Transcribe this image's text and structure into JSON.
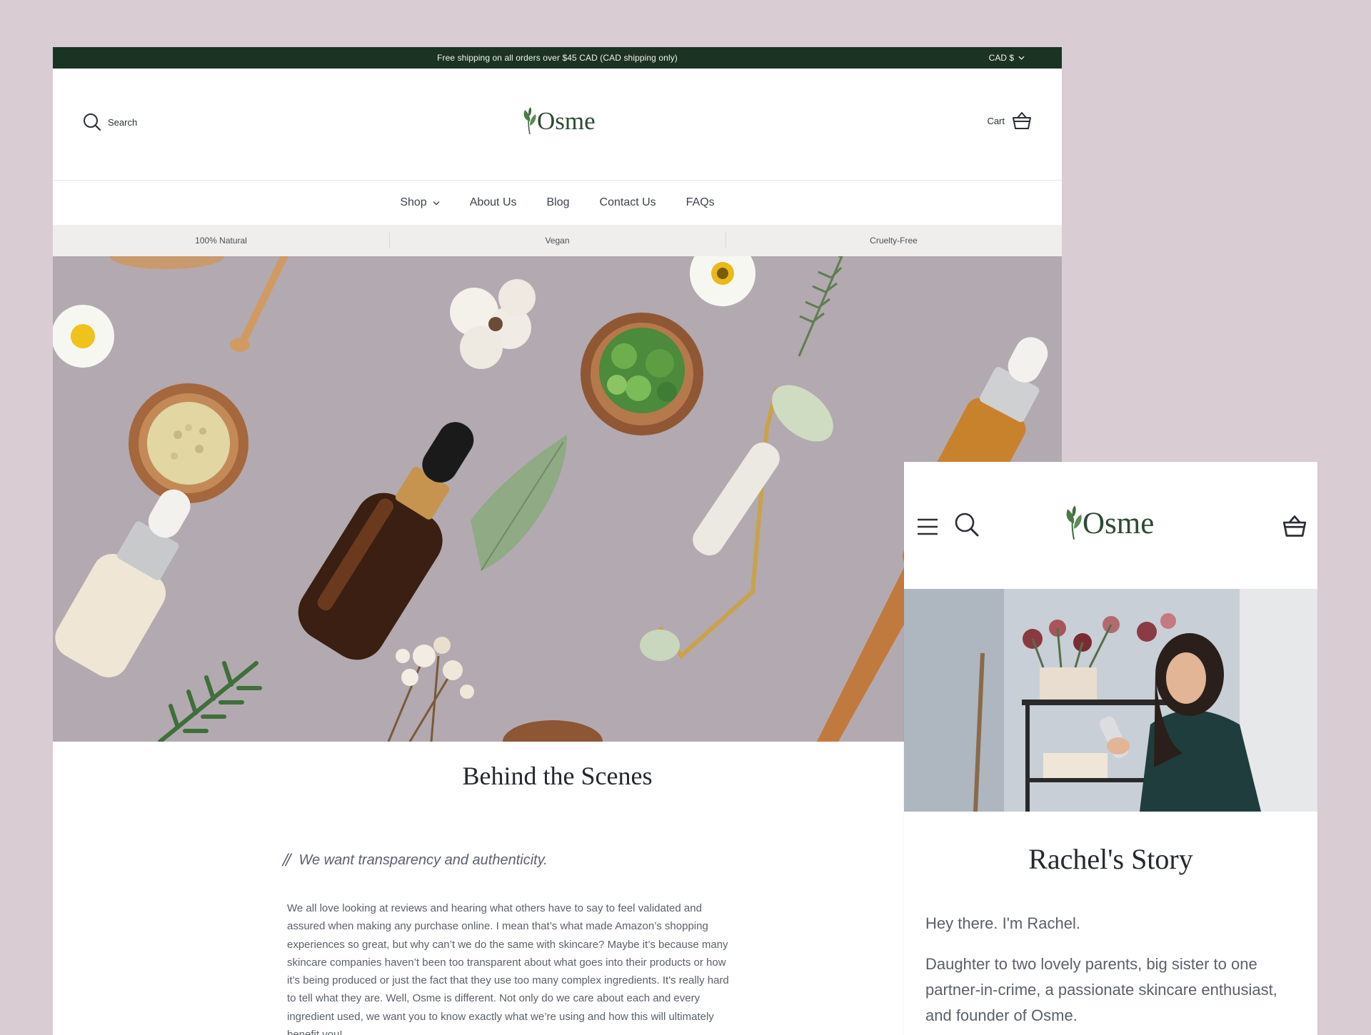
{
  "desktop": {
    "announcement": "Free shipping on all orders over $45 CAD (CAD shipping only)",
    "currency": "CAD $",
    "search_label": "Search",
    "logo_text": "Osme",
    "cart_label": "Cart",
    "nav": [
      {
        "label": "Shop",
        "has_dropdown": true
      },
      {
        "label": "About Us"
      },
      {
        "label": "Blog"
      },
      {
        "label": "Contact Us"
      },
      {
        "label": "FAQs"
      }
    ],
    "usp": [
      "100% Natural",
      "Vegan",
      "Cruelty-Free"
    ],
    "section_title": "Behind the Scenes",
    "quote": "We want transparency and authenticity.",
    "body": "We all love looking at reviews and hearing what others have to say to feel validated and assured when making any purchase online. I mean that’s what made Amazon’s shopping experiences so great, but why can’t we do the same with skincare? Maybe it’s because many skincare companies haven’t been too transparent about what goes into their products or how it’s being produced or just the fact that they use too many complex ingredients. It's really hard to tell what they are. Well, Osme is different. Not only do we care about each and every ingredient used, we want you to know exactly what we’re using and how this will ultimately benefit you!"
  },
  "mobile": {
    "logo_text": "Osme",
    "title": "Rachel's Story",
    "greeting": "Hey there. I'm Rachel.",
    "paragraph": "Daughter to two lovely parents, big sister to one partner-in-crime, a passionate skincare enthusiast, and founder of Osme."
  },
  "colors": {
    "page_background": "#d9ccd3",
    "announcement_bar": "#1b3322",
    "brand_green": "#2e4a33",
    "usp_bar": "#efeeed",
    "hero_background": "#b3a9b0"
  },
  "icons": [
    "search-icon",
    "cart-icon",
    "chevron-down-icon",
    "leaf-logo-icon",
    "hamburger-icon"
  ]
}
